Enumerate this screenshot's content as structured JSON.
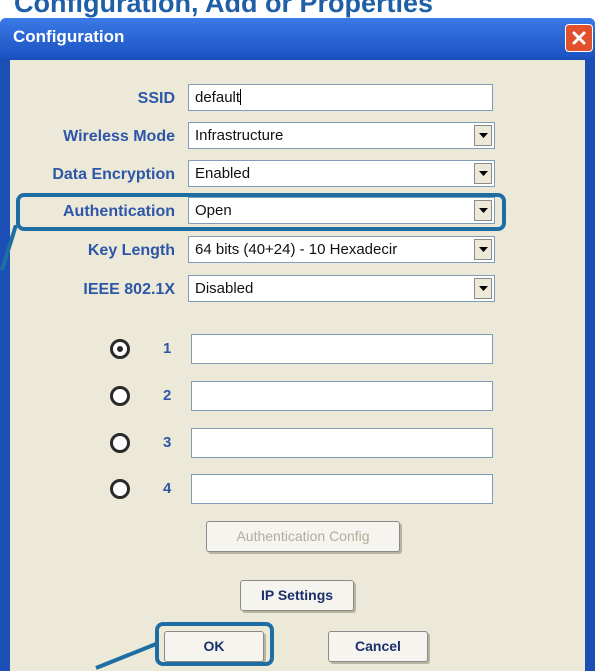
{
  "page_heading": "Configuration, Add or Properties",
  "window": {
    "title": "Configuration"
  },
  "fields": {
    "ssid": {
      "label": "SSID",
      "value": "default"
    },
    "wireless_mode": {
      "label": "Wireless Mode",
      "value": "Infrastructure"
    },
    "data_encryption": {
      "label": "Data Encryption",
      "value": "Enabled"
    },
    "authentication": {
      "label": "Authentication",
      "value": "Open"
    },
    "key_length": {
      "label": "Key Length",
      "value": "64 bits (40+24) - 10 Hexadecir"
    },
    "ieee8021x": {
      "label": "IEEE 802.1X",
      "value": "Disabled"
    }
  },
  "keys": [
    {
      "label": "1",
      "selected": true,
      "value": ""
    },
    {
      "label": "2",
      "selected": false,
      "value": ""
    },
    {
      "label": "3",
      "selected": false,
      "value": ""
    },
    {
      "label": "4",
      "selected": false,
      "value": ""
    }
  ],
  "buttons": {
    "auth_config": "Authentication Config",
    "ip_settings": "IP Settings",
    "ok": "OK",
    "cancel": "Cancel"
  },
  "colors": {
    "title_bar": "#2560d2",
    "panel": "#ece9d8",
    "label": "#2e56a8",
    "highlight": "#1f6ea3",
    "heading": "#1f5fa8"
  },
  "icons": {
    "close": "close-icon",
    "dropdown": "chevron-down-icon"
  }
}
